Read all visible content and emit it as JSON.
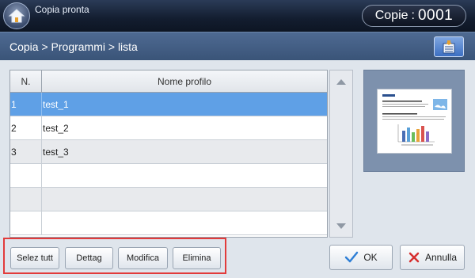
{
  "status": {
    "text": "Copia pronta"
  },
  "counter": {
    "label": "Copie",
    "separator": ":",
    "value": "0001"
  },
  "breadcrumb": {
    "text": "Copia > Programmi > lista"
  },
  "table": {
    "headers": {
      "number": "N.",
      "name": "Nome profilo"
    },
    "rows": [
      {
        "n": "1",
        "name": "test_1",
        "selected": true
      },
      {
        "n": "2",
        "name": "test_2",
        "selected": false
      },
      {
        "n": "3",
        "name": "test_3",
        "selected": false
      },
      {
        "n": "",
        "name": "",
        "selected": false
      },
      {
        "n": "",
        "name": "",
        "selected": false
      },
      {
        "n": "",
        "name": "",
        "selected": false
      }
    ]
  },
  "buttons": {
    "select_all": "Selez tutt",
    "details": "Dettag",
    "modify": "Modifica",
    "delete": "Elimina",
    "ok": "OK",
    "cancel": "Annulla"
  },
  "colors": {
    "selected_row": "#5fa0e6",
    "ok_check": "#2f7fd6",
    "cancel_x": "#d62f2f",
    "highlight_border": "#e23b3b"
  },
  "icons": {
    "home": "home-icon",
    "crumb_button": "list-settings-icon",
    "ok": "check-icon",
    "cancel": "x-icon"
  }
}
